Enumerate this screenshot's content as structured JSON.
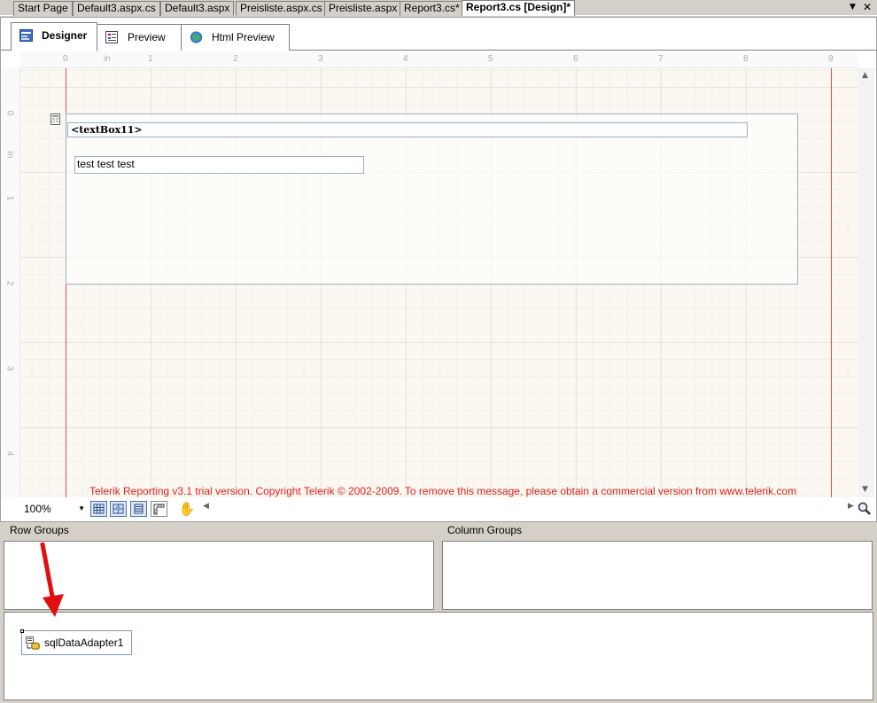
{
  "document_tabs": [
    {
      "label": "Start Page",
      "active": false
    },
    {
      "label": "Default3.aspx.cs",
      "active": false
    },
    {
      "label": "Default3.aspx",
      "active": false
    },
    {
      "label": "Preisliste.aspx.cs",
      "active": false
    },
    {
      "label": "Preisliste.aspx",
      "active": false
    },
    {
      "label": "Report3.cs*",
      "active": false
    },
    {
      "label": "Report3.cs [Design]*",
      "active": true
    }
  ],
  "tab_controls": {
    "dropdown": "▼",
    "close": "✕"
  },
  "view_tabs": [
    {
      "label": "Designer",
      "active": true,
      "icon": "designer-icon"
    },
    {
      "label": "Preview",
      "active": false,
      "icon": "preview-icon"
    },
    {
      "label": "Html Preview",
      "active": false,
      "icon": "globe-icon"
    }
  ],
  "ruler": {
    "unit": "in",
    "h_labels": [
      "0",
      "1",
      "2",
      "3",
      "4",
      "5",
      "6",
      "7",
      "8",
      "9"
    ],
    "v_labels": [
      "0",
      "1",
      "2",
      "3",
      "4"
    ]
  },
  "report": {
    "textbox11": "<textBox11>",
    "test_text": "test test test",
    "trial_message": "Telerik Reporting v3.1 trial version. Copyright Telerik © 2002-2009. To remove this message, please obtain a commercial version from www.telerik.com"
  },
  "zoom": {
    "value": "100%"
  },
  "groups": {
    "row_groups_label": "Row Groups",
    "column_groups_label": "Column Groups"
  },
  "tray": {
    "component_label": "sqlDataAdapter1"
  },
  "colors": {
    "trial_text": "#e02020",
    "margin_line": "#e05050",
    "arrow": "#e01010"
  }
}
